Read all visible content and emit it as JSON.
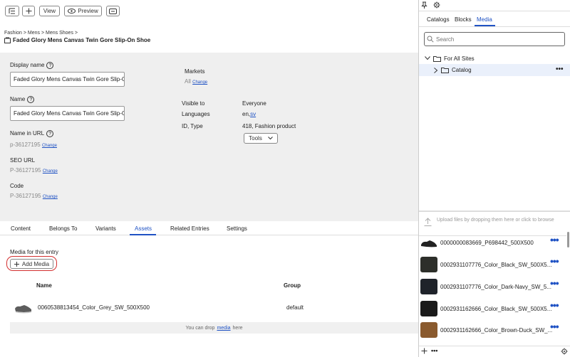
{
  "toolbar": {
    "view_label": "View",
    "preview_label": "Preview"
  },
  "breadcrumb": {
    "items": [
      "Fashion",
      "Mens",
      "Mens Shoes"
    ],
    "title": "Faded Glory Mens Canvas Twin Gore Slip-On Shoe"
  },
  "form": {
    "display_name_label": "Display name",
    "display_name_value": "Faded Glory Mens Canvas Twin Gore Slip-On Shoe",
    "name_label": "Name",
    "name_value": "Faded Glory Mens Canvas Twin Gore Slip-On Shoe",
    "name_in_url_label": "Name in URL",
    "name_in_url_value": "p-36127195",
    "seo_url_label": "SEO URL",
    "seo_url_value": "P-36127195",
    "code_label": "Code",
    "code_value": "P-36127195",
    "change_label": "Change"
  },
  "info": {
    "markets_label": "Markets",
    "markets_value": "All",
    "visible_to_label": "Visible to",
    "visible_to_value": "Everyone",
    "languages_label": "Languages",
    "languages_value": "en,",
    "languages_link": "sv",
    "id_type_label": "ID, Type",
    "id_type_value": "418, Fashion product",
    "tools_label": "Tools"
  },
  "tabs": [
    "Content",
    "Belongs To",
    "Variants",
    "Assets",
    "Related Entries",
    "Settings"
  ],
  "active_tab": "Assets",
  "assets": {
    "section_title": "Media for this entry",
    "add_media_label": "Add Media",
    "col_name": "Name",
    "col_group": "Group",
    "rows": [
      {
        "name": "0060538813454_Color_Grey_SW_500X500",
        "group": "default"
      }
    ],
    "drop_text_before": "You can drop",
    "drop_link": "media",
    "drop_text_after": "here"
  },
  "right_panel": {
    "tabs": [
      "Catalogs",
      "Blocks",
      "Media"
    ],
    "active_tab": "Media",
    "search_placeholder": "Search",
    "tree": [
      {
        "label": "For All Sites"
      },
      {
        "label": "Catalog"
      }
    ],
    "upload_text": "Upload files by dropping them here or click to browse",
    "media_items": [
      "0000000083669_P698442_500X500",
      "0002931107776_Color_Black_SW_500X5...",
      "0002931107776_Color_Dark-Navy_SW_5...",
      "0002931162666_Color_Black_SW_500X5...",
      "0002931162666_Color_Brown-Duck_SW_..."
    ]
  },
  "colors": {
    "accent": "#1f52c4",
    "form_background": "#efefef",
    "highlight_ring": "#d32f2f"
  }
}
